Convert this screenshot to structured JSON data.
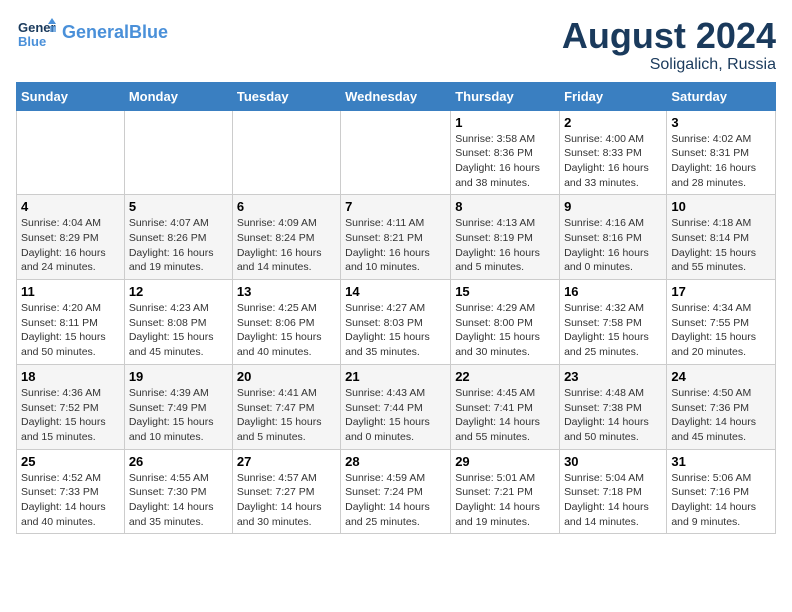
{
  "header": {
    "logo_line1": "General",
    "logo_line2": "Blue",
    "title": "August 2024",
    "subtitle": "Soligalich, Russia"
  },
  "weekdays": [
    "Sunday",
    "Monday",
    "Tuesday",
    "Wednesday",
    "Thursday",
    "Friday",
    "Saturday"
  ],
  "weeks": [
    [
      {
        "day": "",
        "info": ""
      },
      {
        "day": "",
        "info": ""
      },
      {
        "day": "",
        "info": ""
      },
      {
        "day": "",
        "info": ""
      },
      {
        "day": "1",
        "info": "Sunrise: 3:58 AM\nSunset: 8:36 PM\nDaylight: 16 hours\nand 38 minutes."
      },
      {
        "day": "2",
        "info": "Sunrise: 4:00 AM\nSunset: 8:33 PM\nDaylight: 16 hours\nand 33 minutes."
      },
      {
        "day": "3",
        "info": "Sunrise: 4:02 AM\nSunset: 8:31 PM\nDaylight: 16 hours\nand 28 minutes."
      }
    ],
    [
      {
        "day": "4",
        "info": "Sunrise: 4:04 AM\nSunset: 8:29 PM\nDaylight: 16 hours\nand 24 minutes."
      },
      {
        "day": "5",
        "info": "Sunrise: 4:07 AM\nSunset: 8:26 PM\nDaylight: 16 hours\nand 19 minutes."
      },
      {
        "day": "6",
        "info": "Sunrise: 4:09 AM\nSunset: 8:24 PM\nDaylight: 16 hours\nand 14 minutes."
      },
      {
        "day": "7",
        "info": "Sunrise: 4:11 AM\nSunset: 8:21 PM\nDaylight: 16 hours\nand 10 minutes."
      },
      {
        "day": "8",
        "info": "Sunrise: 4:13 AM\nSunset: 8:19 PM\nDaylight: 16 hours\nand 5 minutes."
      },
      {
        "day": "9",
        "info": "Sunrise: 4:16 AM\nSunset: 8:16 PM\nDaylight: 16 hours\nand 0 minutes."
      },
      {
        "day": "10",
        "info": "Sunrise: 4:18 AM\nSunset: 8:14 PM\nDaylight: 15 hours\nand 55 minutes."
      }
    ],
    [
      {
        "day": "11",
        "info": "Sunrise: 4:20 AM\nSunset: 8:11 PM\nDaylight: 15 hours\nand 50 minutes."
      },
      {
        "day": "12",
        "info": "Sunrise: 4:23 AM\nSunset: 8:08 PM\nDaylight: 15 hours\nand 45 minutes."
      },
      {
        "day": "13",
        "info": "Sunrise: 4:25 AM\nSunset: 8:06 PM\nDaylight: 15 hours\nand 40 minutes."
      },
      {
        "day": "14",
        "info": "Sunrise: 4:27 AM\nSunset: 8:03 PM\nDaylight: 15 hours\nand 35 minutes."
      },
      {
        "day": "15",
        "info": "Sunrise: 4:29 AM\nSunset: 8:00 PM\nDaylight: 15 hours\nand 30 minutes."
      },
      {
        "day": "16",
        "info": "Sunrise: 4:32 AM\nSunset: 7:58 PM\nDaylight: 15 hours\nand 25 minutes."
      },
      {
        "day": "17",
        "info": "Sunrise: 4:34 AM\nSunset: 7:55 PM\nDaylight: 15 hours\nand 20 minutes."
      }
    ],
    [
      {
        "day": "18",
        "info": "Sunrise: 4:36 AM\nSunset: 7:52 PM\nDaylight: 15 hours\nand 15 minutes."
      },
      {
        "day": "19",
        "info": "Sunrise: 4:39 AM\nSunset: 7:49 PM\nDaylight: 15 hours\nand 10 minutes."
      },
      {
        "day": "20",
        "info": "Sunrise: 4:41 AM\nSunset: 7:47 PM\nDaylight: 15 hours\nand 5 minutes."
      },
      {
        "day": "21",
        "info": "Sunrise: 4:43 AM\nSunset: 7:44 PM\nDaylight: 15 hours\nand 0 minutes."
      },
      {
        "day": "22",
        "info": "Sunrise: 4:45 AM\nSunset: 7:41 PM\nDaylight: 14 hours\nand 55 minutes."
      },
      {
        "day": "23",
        "info": "Sunrise: 4:48 AM\nSunset: 7:38 PM\nDaylight: 14 hours\nand 50 minutes."
      },
      {
        "day": "24",
        "info": "Sunrise: 4:50 AM\nSunset: 7:36 PM\nDaylight: 14 hours\nand 45 minutes."
      }
    ],
    [
      {
        "day": "25",
        "info": "Sunrise: 4:52 AM\nSunset: 7:33 PM\nDaylight: 14 hours\nand 40 minutes."
      },
      {
        "day": "26",
        "info": "Sunrise: 4:55 AM\nSunset: 7:30 PM\nDaylight: 14 hours\nand 35 minutes."
      },
      {
        "day": "27",
        "info": "Sunrise: 4:57 AM\nSunset: 7:27 PM\nDaylight: 14 hours\nand 30 minutes."
      },
      {
        "day": "28",
        "info": "Sunrise: 4:59 AM\nSunset: 7:24 PM\nDaylight: 14 hours\nand 25 minutes."
      },
      {
        "day": "29",
        "info": "Sunrise: 5:01 AM\nSunset: 7:21 PM\nDaylight: 14 hours\nand 19 minutes."
      },
      {
        "day": "30",
        "info": "Sunrise: 5:04 AM\nSunset: 7:18 PM\nDaylight: 14 hours\nand 14 minutes."
      },
      {
        "day": "31",
        "info": "Sunrise: 5:06 AM\nSunset: 7:16 PM\nDaylight: 14 hours\nand 9 minutes."
      }
    ]
  ]
}
